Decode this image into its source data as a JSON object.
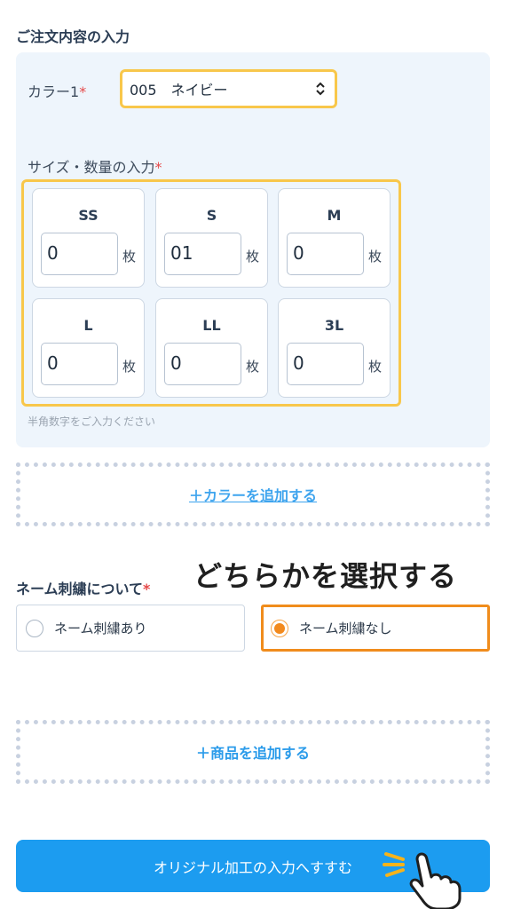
{
  "order": {
    "section_title": "ご注文内容の入力",
    "color": {
      "label": "カラー1",
      "required_mark": "*",
      "selected_value": "005　ネイビー",
      "highlight_color": "#f8c74b"
    },
    "size": {
      "label": "サイズ・数量の入力",
      "required_mark": "*",
      "unit": "枚",
      "hint": "半角数字をご入力ください",
      "cells": [
        {
          "name": "SS",
          "value": "0"
        },
        {
          "name": "S",
          "value": "01"
        },
        {
          "name": "M",
          "value": "0"
        },
        {
          "name": "L",
          "value": "0"
        },
        {
          "name": "LL",
          "value": "0"
        },
        {
          "name": "3L",
          "value": "0"
        }
      ]
    },
    "add_color_label": "＋カラーを追加する",
    "embroidery": {
      "label": "ネーム刺繍について",
      "required_mark": "*",
      "annotation": "どちらかを選択する",
      "options": [
        {
          "label": "ネーム刺繍あり",
          "selected": false
        },
        {
          "label": "ネーム刺繍なし",
          "selected": true
        }
      ],
      "selected_color": "#f28a1e"
    },
    "add_product_label": "＋商品を追加する",
    "cta_label": "オリジナル加工の入力へすすむ",
    "cta_color": "#1c9cf0",
    "cta_icon": "pointer-hand-icon"
  }
}
